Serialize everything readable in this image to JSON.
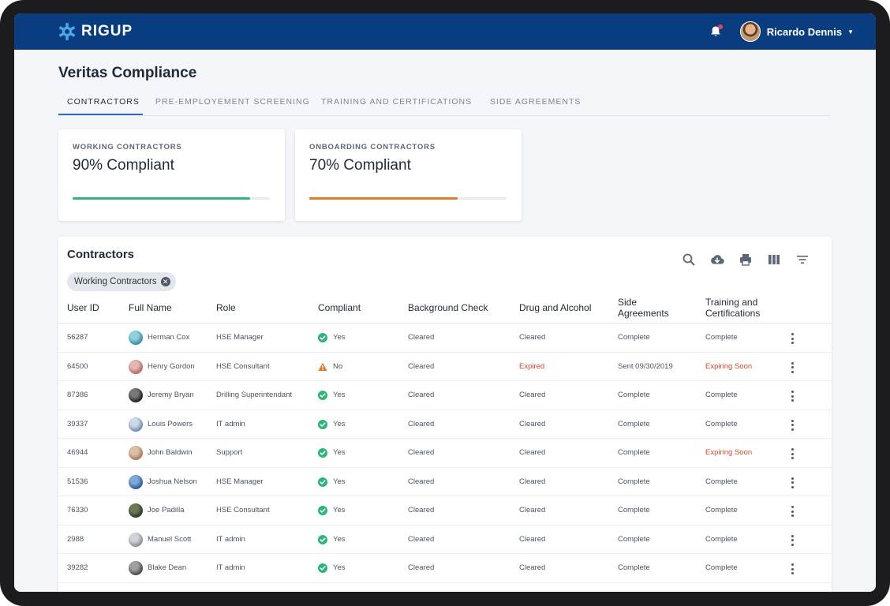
{
  "app": {
    "logo_text": "RIGUP",
    "user_name": "Ricardo Dennis",
    "colors": {
      "nav": "#0a3d80",
      "green": "#2fb47c",
      "orange": "#e07b24",
      "red": "#d24a2e",
      "accent": "#2f6fb5"
    }
  },
  "page": {
    "title": "Veritas Compliance",
    "tabs": [
      "CONTRACTORS",
      "PRE-EMPLOYEMENT SCREENING",
      "TRAINING AND CERTIFICATIONS",
      "SIDE AGREEMENTS"
    ],
    "active_tab": 0
  },
  "cards": [
    {
      "label": "WORKING CONTRACTORS",
      "value": "90% Compliant",
      "progress": 0.9,
      "color": "#2fb47c"
    },
    {
      "label": "ONBOARDING CONTRACTORS",
      "value": "70% Compliant",
      "progress": 0.75,
      "color": "#e07b24"
    }
  ],
  "table": {
    "title": "Contractors",
    "filter_chip": "Working Contractors",
    "toolbar_icons": [
      "search-icon",
      "cloud-download-icon",
      "print-icon",
      "columns-icon",
      "filter-icon"
    ],
    "columns": {
      "user_id": "User ID",
      "full_name": "Full Name",
      "role": "Role",
      "compliant": "Compliant",
      "background": "Background Check",
      "drug": "Drug and Alcohol",
      "side_1": "Side",
      "side_2": "Agreements",
      "training_1": "Training and",
      "training_2": "Certifications"
    },
    "rows": [
      {
        "id": "56287",
        "name": "Herman Cox",
        "role": "HSE Manager",
        "compliant": "Yes",
        "background": "Cleared",
        "drug": "Cleared",
        "side": "Complete",
        "training": "Complete"
      },
      {
        "id": "64500",
        "name": "Henry Gordon",
        "role": "HSE Consultant",
        "compliant": "No",
        "background": "Cleared",
        "drug": "Expired",
        "side": "Sent 09/30/2019",
        "training": "Expiring Soon"
      },
      {
        "id": "87386",
        "name": "Jeremy Bryan",
        "role": "Drilling Superintendant",
        "compliant": "Yes",
        "background": "Cleared",
        "drug": "Cleared",
        "side": "Complete",
        "training": "Complete"
      },
      {
        "id": "39337",
        "name": "Louis Powers",
        "role": "IT admin",
        "compliant": "Yes",
        "background": "Cleared",
        "drug": "Cleared",
        "side": "Complete",
        "training": "Complete"
      },
      {
        "id": "46944",
        "name": "John Baldwin",
        "role": "Support",
        "compliant": "Yes",
        "background": "Cleared",
        "drug": "Cleared",
        "side": "Complete",
        "training": "Expiring Soon"
      },
      {
        "id": "51536",
        "name": "Joshua Nelson",
        "role": "HSE Manager",
        "compliant": "Yes",
        "background": "Cleared",
        "drug": "Cleared",
        "side": "Complete",
        "training": "Complete"
      },
      {
        "id": "76330",
        "name": "Joe Padilla",
        "role": "HSE Consultant",
        "compliant": "Yes",
        "background": "Cleared",
        "drug": "Cleared",
        "side": "Complete",
        "training": "Complete"
      },
      {
        "id": "2988",
        "name": "Manuel Scott",
        "role": "IT admin",
        "compliant": "Yes",
        "background": "Cleared",
        "drug": "Cleared",
        "side": "Complete",
        "training": "Complete"
      },
      {
        "id": "39282",
        "name": "Blake Dean",
        "role": "IT admin",
        "compliant": "Yes",
        "background": "Cleared",
        "drug": "Cleared",
        "side": "Complete",
        "training": "Complete"
      }
    ]
  }
}
